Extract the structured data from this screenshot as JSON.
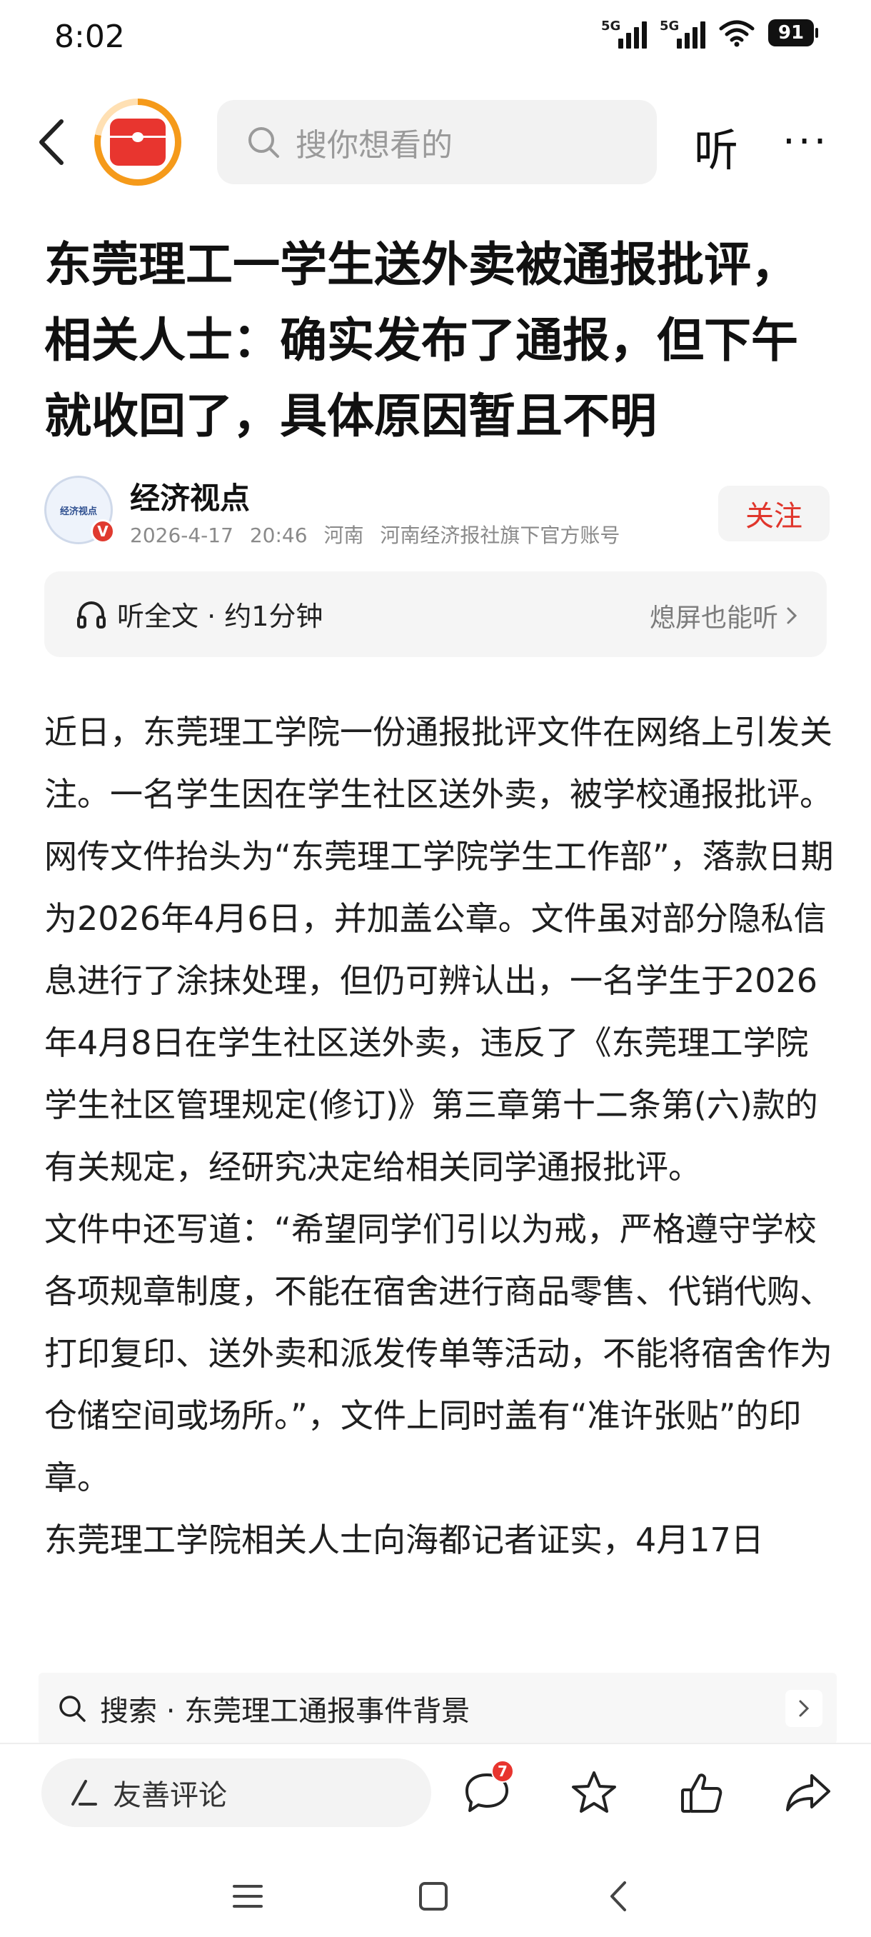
{
  "status_bar": {
    "time": "8:02",
    "signal1_tag": "5G",
    "signal2_tag": "5G",
    "battery": "91"
  },
  "top_nav": {
    "search_placeholder": "搜你想看的",
    "listen_label": "听",
    "more_label": "···"
  },
  "article": {
    "title": "东莞理工一学生送外卖被通报批评，相关人士：确实发布了通报，但下午就收回了，具体原因暂且不明",
    "author": {
      "avatar_text": "经济视点",
      "verified_mark": "V",
      "name": "经济视点",
      "date": "2026-4-17",
      "time": "20:46",
      "location": "河南",
      "description": "河南经济报社旗下官方账号",
      "follow_label": "关注"
    },
    "listen_bar": {
      "label": "听全文 · 约1分钟",
      "screen_off": "熄屏也能听"
    },
    "paragraphs": [
      "近日，东莞理工学院一份通报批评文件在网络上引发关注。一名学生因在学生社区送外卖，被学校通报批评。",
      "网传文件抬头为“东莞理工学院学生工作部”，落款日期为2026年4月6日，并加盖公章。文件虽对部分隐私信息进行了涂抹处理，但仍可辨认出，一名学生于2026年4月8日在学生社区送外卖，违反了《东莞理工学院学生社区管理规定(修订)》第三章第十二条第(六)款的有关规定，经研究决定给相关同学通报批评。",
      "文件中还写道：“希望同学们引以为戒，严格遵守学校各项规章制度，不能在宿舍进行商品零售、代销代购、打印复印、送外卖和派发传单等活动，不能将宿舍作为仓储空间或场所。”，文件上同时盖有“准许张贴”的印章。",
      "东莞理工学院相关人士向海都记者证实，4月17日"
    ]
  },
  "search_suggestion": {
    "label": "搜索 · 东莞理工通报事件背景"
  },
  "bottom_bar": {
    "comment_placeholder": "友善评论",
    "comment_count": "7"
  }
}
